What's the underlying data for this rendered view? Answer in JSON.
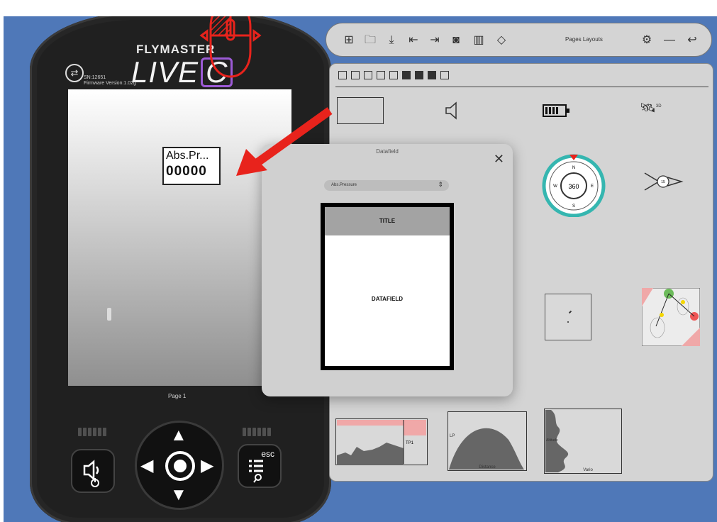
{
  "device": {
    "brand": "FLYMASTER",
    "model_live": "LIVE",
    "model_c": "C",
    "serial": "SN:12651",
    "firmware": "Firmware Version:1.02g",
    "page_label": "Page 1",
    "widget": {
      "title": "Abs.Pr...",
      "value": "00000"
    },
    "keys": {
      "esc_label": "esc"
    }
  },
  "toolbar": {
    "title": "Pages Layouts",
    "icons": [
      "add-page-icon",
      "open-folder-icon",
      "download-icon",
      "import-icon",
      "export-icon",
      "save-icon",
      "text-field-icon",
      "rotate-icon",
      "settings-icon",
      "minimize-icon",
      "back-icon"
    ]
  },
  "dialog": {
    "title": "Datafield",
    "select_value": "Abs.Pressure",
    "preview_title": "TITLE",
    "preview_datafield": "DATAFIELD"
  },
  "panel": {
    "compass_value": "360",
    "compass_n": "N",
    "compass_s": "S",
    "compass_e": "E",
    "compass_w": "W",
    "wind_value": "15",
    "gps_fix": "3D",
    "route_label": "TP1",
    "glide_x_label": "Distance",
    "glide_y_label": "LP",
    "vario_x_label": "Vario",
    "vario_y_label": "Altitude"
  },
  "colors": {
    "background": "#4f78b8",
    "accent_red": "#e8231c",
    "compass_teal": "#35b6b0"
  }
}
